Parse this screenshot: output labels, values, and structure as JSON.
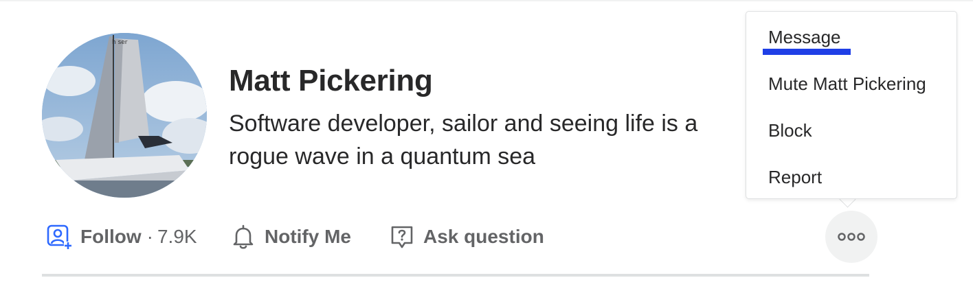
{
  "profile": {
    "name": "Matt Pickering",
    "bio": "Software developer, sailor and seeing life is a rogue wave in a quantum sea",
    "avatar_alt": "sailboat photo"
  },
  "actions": {
    "follow_label": "Follow",
    "separator": "·",
    "follower_count": "7.9K",
    "notify_label": "Notify Me",
    "ask_label": "Ask question",
    "more_icon": "more-horizontal-icon"
  },
  "menu": {
    "items": [
      {
        "label": "Message"
      },
      {
        "label": "Mute Matt Pickering"
      },
      {
        "label": "Block"
      },
      {
        "label": "Report"
      }
    ],
    "focused_index": 0
  },
  "colors": {
    "accent_blue": "#2e69ff",
    "focus_underline": "#1f3fe6",
    "text_primary": "#282829",
    "text_secondary": "#636466",
    "divider": "#dee0e1",
    "more_button_bg": "#f1f2f2"
  },
  "icons": {
    "follow": "person-add-icon",
    "notify": "bell-icon",
    "ask": "question-bubble-icon"
  }
}
